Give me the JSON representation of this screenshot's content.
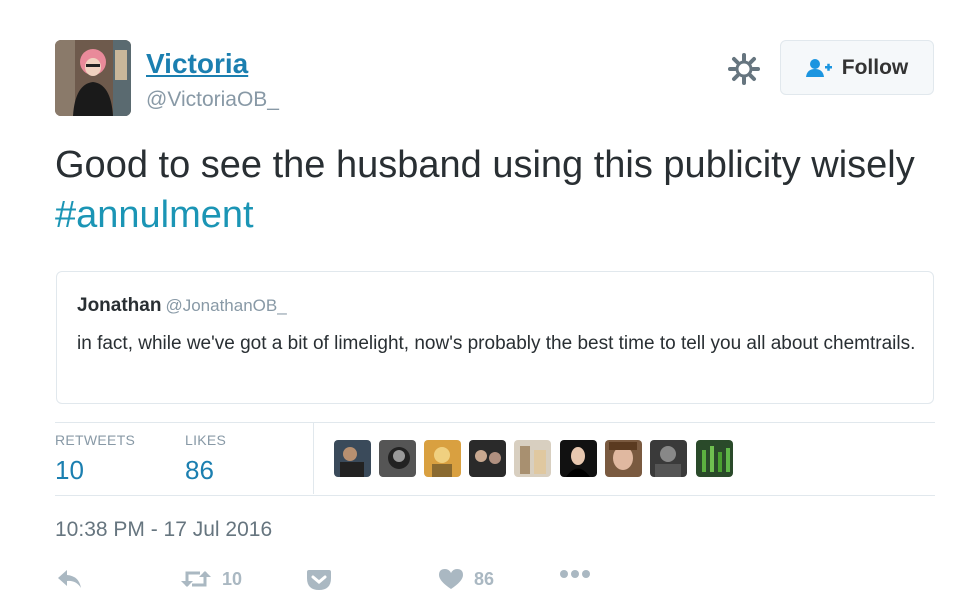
{
  "author": {
    "name": "Victoria",
    "handle": "@VictoriaOB_"
  },
  "header": {
    "follow_label": "Follow"
  },
  "tweet": {
    "text": "Good to see the husband using this publicity wisely ",
    "hashtag": "#annulment"
  },
  "quoted": {
    "name": "Jonathan",
    "handle": "@JonathanOB_",
    "text": "in fact, while we've got a bit of limelight, now's probably the best time to tell you all about chemtrails."
  },
  "stats": {
    "retweets_label": "RETWEETS",
    "retweets": "10",
    "likes_label": "LIKES",
    "likes": "86"
  },
  "timestamp": "10:38 PM - 17 Jul 2016",
  "actions": {
    "retweet_count": "10",
    "like_count": "86"
  },
  "colors": {
    "link": "#1b7fb0",
    "hashtag": "#1b95b5",
    "muted": "#8899a6",
    "icon": "#aab8c2"
  }
}
